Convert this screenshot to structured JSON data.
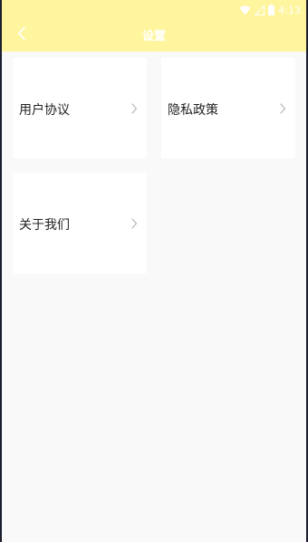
{
  "status_bar": {
    "time": "4:13",
    "icons": [
      "wifi-icon",
      "signal-icon",
      "battery-icon"
    ]
  },
  "header": {
    "title": "设置",
    "back_icon": "chevron-left-icon",
    "background_color": "#fff59e"
  },
  "settings": {
    "items": [
      {
        "label": "用户协议",
        "icon": "chevron-right-icon"
      },
      {
        "label": "隐私政策",
        "icon": "chevron-right-icon"
      },
      {
        "label": "关于我们",
        "icon": "chevron-right-icon"
      }
    ]
  },
  "colors": {
    "page_background": "#f9f9f9",
    "card_background": "#ffffff"
  }
}
